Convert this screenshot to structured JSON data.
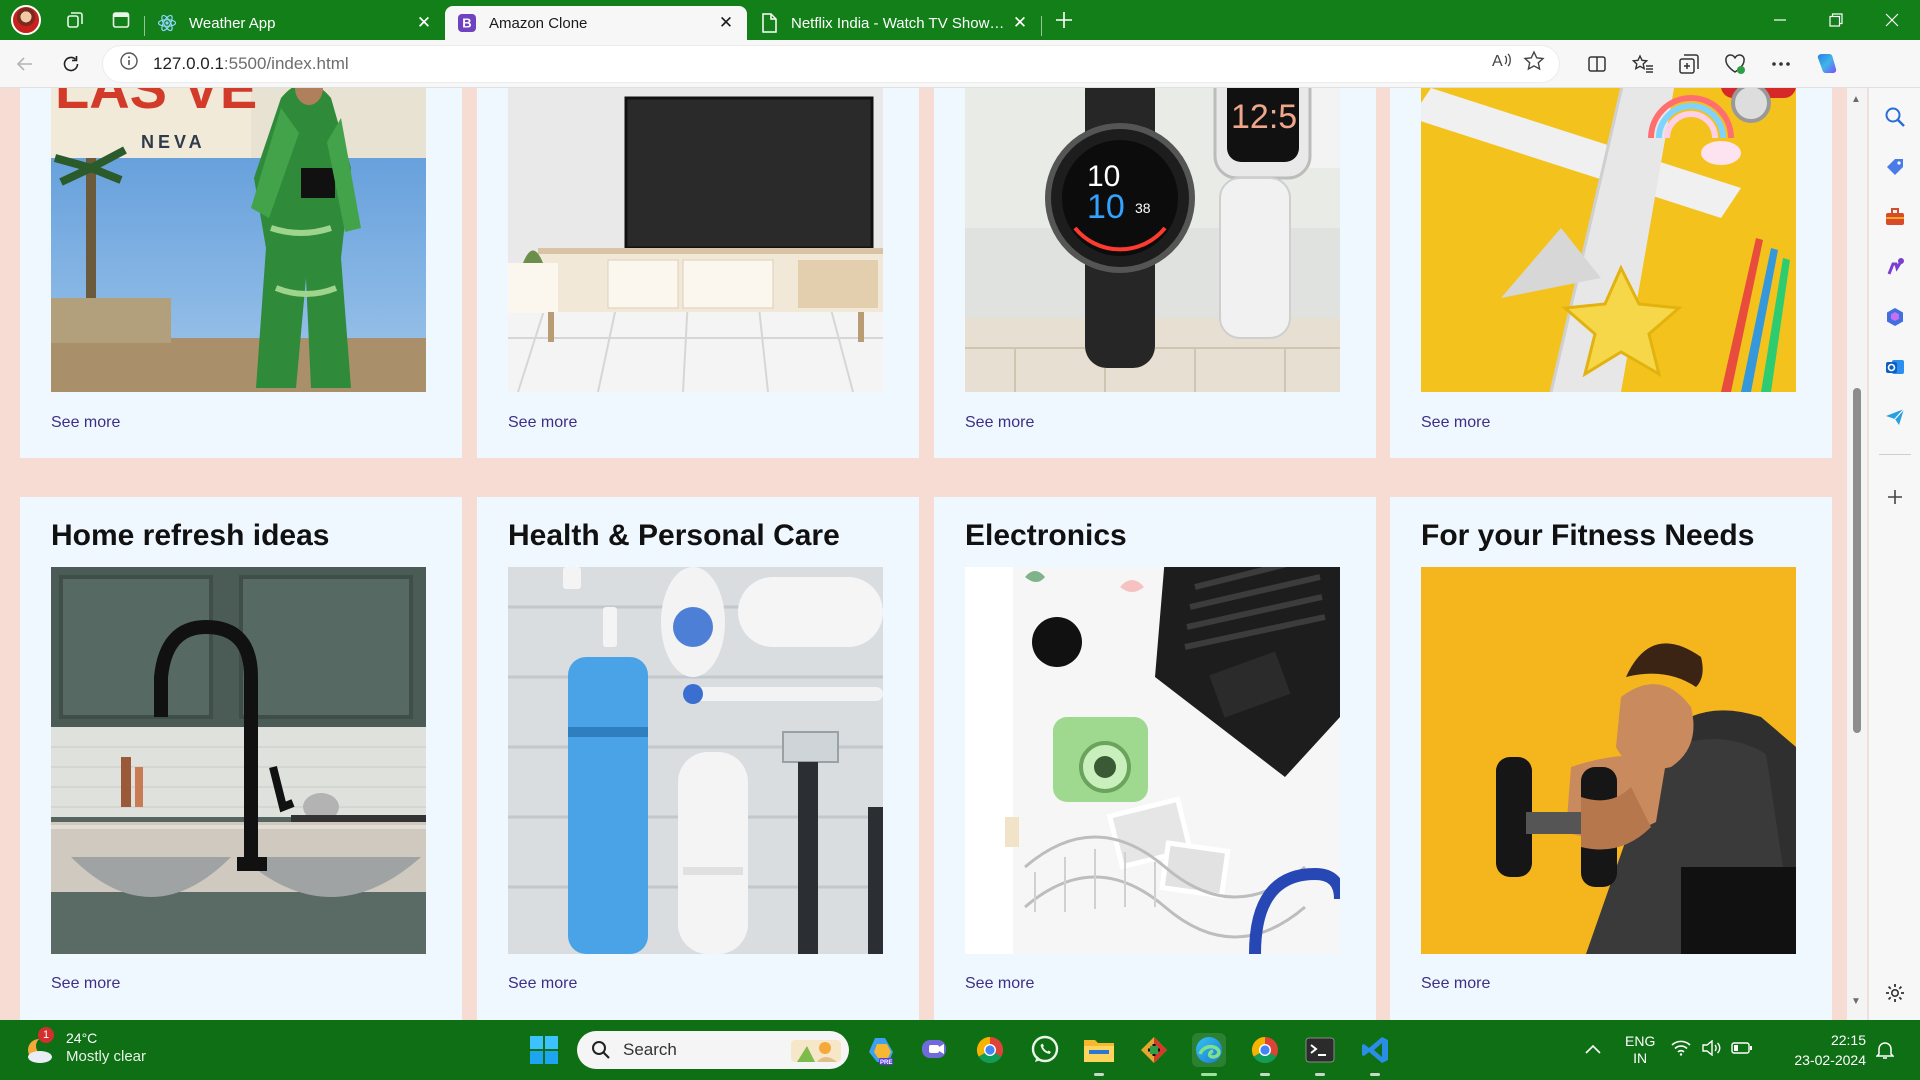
{
  "browser": {
    "tabs": [
      {
        "title": "Weather App",
        "active": false
      },
      {
        "title": "Amazon Clone",
        "active": true
      },
      {
        "title": "Netflix India - Watch TV Shows Online",
        "active": false
      }
    ],
    "url": {
      "host": "127.0.0.1",
      "rest": ":5500/index.html"
    }
  },
  "page": {
    "top_row": [
      {
        "see_more": "See more",
        "image": "fashion-lady-las-vegas"
      },
      {
        "see_more": "See more",
        "image": "tv-on-cabinet"
      },
      {
        "see_more": "See more",
        "image": "smartwatches"
      },
      {
        "see_more": "See more",
        "image": "toys-airplane"
      }
    ],
    "bottom_row": [
      {
        "title": "Home refresh ideas",
        "see_more": "See more",
        "image": "kitchen-faucet"
      },
      {
        "title": "Health & Personal Care",
        "see_more": "See more",
        "image": "personal-care-products"
      },
      {
        "title": "Electronics",
        "see_more": "See more",
        "image": "laptop-camera-headphones"
      },
      {
        "title": "For your Fitness Needs",
        "see_more": "See more",
        "image": "man-lifting-dumbbell"
      }
    ]
  },
  "taskbar": {
    "weather": {
      "temp": "24°C",
      "condition": "Mostly clear",
      "badge": "1"
    },
    "search_label": "Search",
    "lang": {
      "line1": "ENG",
      "line2": "IN"
    },
    "time": "22:15",
    "date": "23-02-2024"
  },
  "colors": {
    "titlebar": "#127f19",
    "taskbar": "#0f6f15",
    "page_bg": "#f7dcd3",
    "card_bg": "#eff7ff",
    "link": "#3e2f86"
  }
}
